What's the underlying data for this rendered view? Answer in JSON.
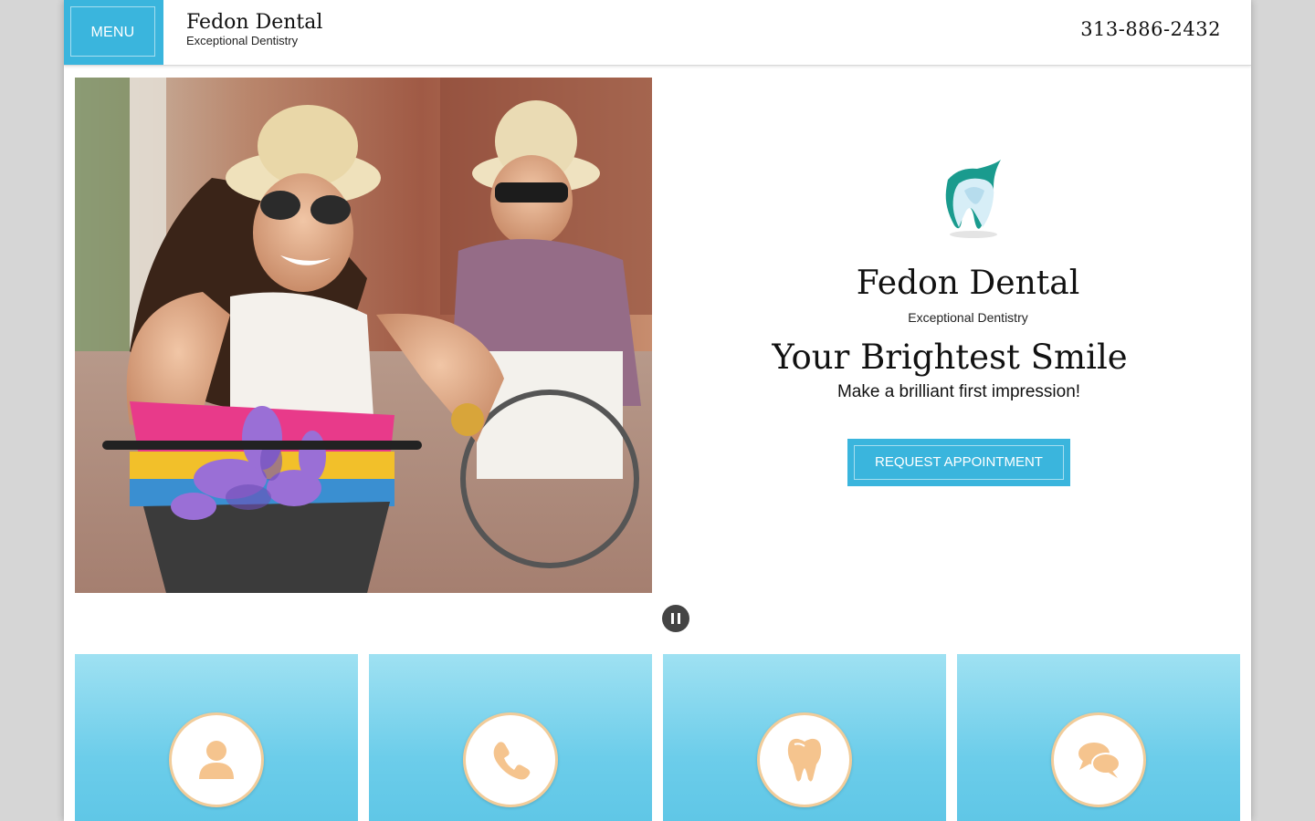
{
  "header": {
    "menu_label": "MENU",
    "brand_name": "Fedon Dental",
    "brand_tagline": "Exceptional Dentistry",
    "phone": "313-886-2432"
  },
  "hero": {
    "photo_icon": "couple-on-bicycles-photo",
    "logo_icon": "tooth-logo-icon",
    "brand_name": "Fedon Dental",
    "brand_tagline": "Exceptional Dentistry",
    "headline": "Your Brightest Smile",
    "subheadline": "Make a brilliant first impression!",
    "cta_label": "REQUEST APPOINTMENT"
  },
  "slider": {
    "pause_icon": "pause-icon"
  },
  "tiles": [
    {
      "icon": "user-icon"
    },
    {
      "icon": "phone-icon"
    },
    {
      "icon": "tooth-icon"
    },
    {
      "icon": "chat-icon"
    }
  ],
  "colors": {
    "accent": "#3ab5dd",
    "tile_top": "#9fe1f2",
    "tile_bottom": "#5ec6e6",
    "icon_color": "#f5c48e",
    "logo_teal": "#1a9b8e"
  }
}
